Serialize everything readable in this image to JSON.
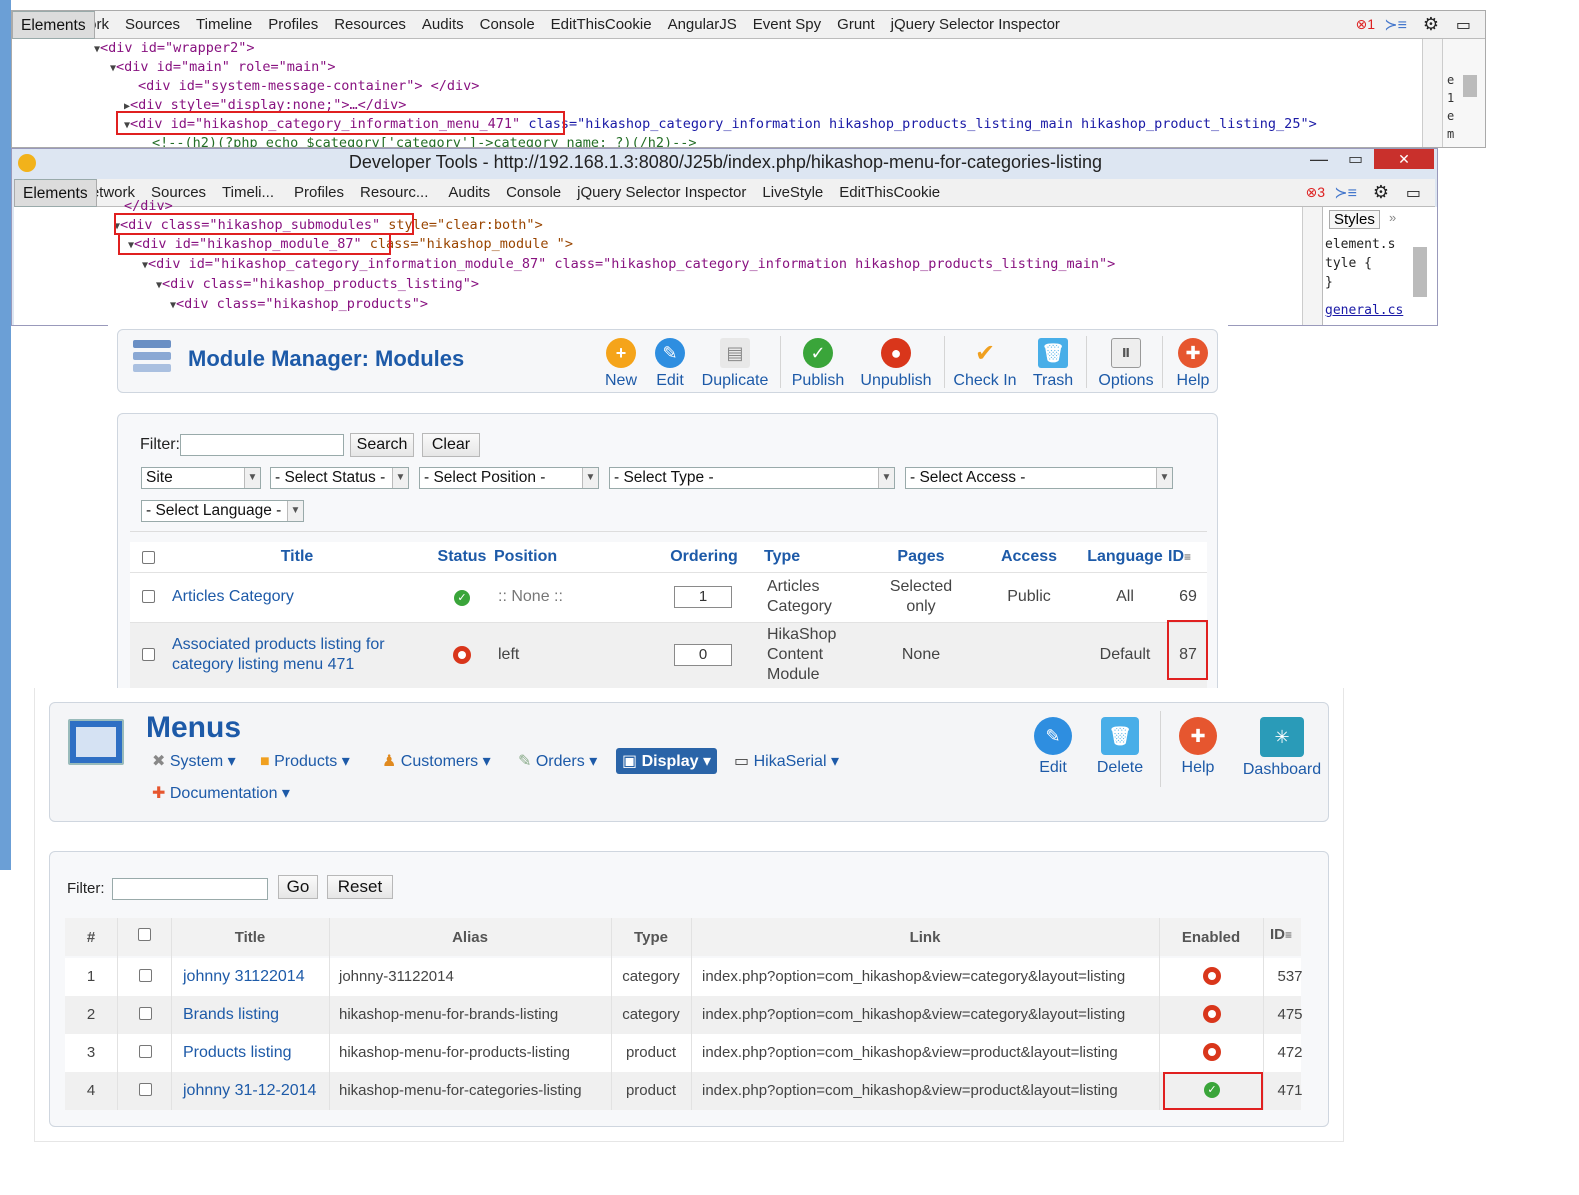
{
  "devtools1": {
    "tabs": [
      "Elements",
      "Network",
      "Sources",
      "Timeline",
      "Profiles",
      "Resources",
      "Audits",
      "Console",
      "EditThisCookie",
      "AngularJS",
      "Event Spy",
      "Grunt",
      "jQuery Selector Inspector"
    ],
    "error_count": "1",
    "lines": [
      {
        "tag": "<div id=\"wrapper2\">"
      },
      {
        "tag": "<div id=\"main\" role=\"main\">"
      },
      {
        "tag": "<div id=\"system-message-container\"> </div>"
      },
      {
        "tag": "<div style=\"display:none;\">…</div>"
      },
      {
        "tag": "<div id=\"hikashop_category_information_menu_471\"",
        "rest": "class=\"hikashop_category_information hikashop_products_listing_main hikashop_product_listing_25\">"
      },
      {
        "tag": "<!--(h2)(?php echo $category['category']->category_name; ?)(/h2)-->"
      }
    ],
    "side": [
      "e",
      "1",
      "e",
      "m"
    ]
  },
  "devtools2": {
    "title": "Developer Tools - http://192.168.1.3:8080/J25b/index.php/hikashop-menu-for-categories-listing",
    "tabs": [
      "Elements",
      "Network",
      "Sources",
      "Timeli...",
      "Profiles",
      "Resourc...",
      "Audits",
      "Console",
      "jQuery Selector Inspector",
      "LiveStyle",
      "EditThisCookie"
    ],
    "error_count": "3",
    "lines": [
      {
        "tag": "</div>"
      },
      {
        "tag": "<div class=\"hikashop_submodules\"",
        "rest": "style=\"clear:both\">"
      },
      {
        "tag": "<div id=\"hikashop_module_87\"",
        "rest": "class=\"hikashop_module \">"
      },
      {
        "tag": "<div id=\"hikashop_category_information_module_87\" class=\"hikashop_category_information hikashop_products_listing_main\">"
      },
      {
        "tag": "<div class=\"hikashop_products_listing\">"
      },
      {
        "tag": "<div class=\"hikashop_products\">"
      }
    ],
    "styles_tab": "Styles",
    "styles_lines": [
      "element.s",
      "tyle {",
      "}",
      "general.cs"
    ]
  },
  "module_manager": {
    "title": "Module Manager: Modules",
    "toolbar": [
      "New",
      "Edit",
      "Duplicate",
      "Publish",
      "Unpublish",
      "Check In",
      "Trash",
      "Options",
      "Help"
    ],
    "filter_label": "Filter:",
    "search_btn": "Search",
    "clear_btn": "Clear",
    "selects": [
      "Site",
      "- Select Status -",
      "- Select Position -",
      "- Select Type -",
      "- Select Access -",
      "- Select Language -"
    ],
    "headers": [
      "Title",
      "Status",
      "Position",
      "Ordering",
      "Type",
      "Pages",
      "Access",
      "Language",
      "ID"
    ],
    "rows": [
      {
        "title": "Articles Category",
        "position": ":: None ::",
        "ordering": "1",
        "type1": "Articles",
        "type2": "Category",
        "type3": "",
        "pages1": "Selected",
        "pages2": "only",
        "access": "Public",
        "language": "All",
        "id": "69"
      },
      {
        "title": "Associated products listing for",
        "title2": "category listing menu 471",
        "position": "left",
        "ordering": "0",
        "type1": "HikaShop",
        "type2": "Content",
        "type3": "Module",
        "pages1": "None",
        "pages2": "",
        "access": "",
        "language": "Default",
        "id": "87"
      }
    ]
  },
  "menus": {
    "title": "Menus",
    "nav": [
      "System",
      "Products",
      "Customers",
      "Orders",
      "Display",
      "HikaSerial",
      "Documentation"
    ],
    "toolbar": [
      "Edit",
      "Delete",
      "Help",
      "Dashboard"
    ],
    "filter_label": "Filter:",
    "go_btn": "Go",
    "reset_btn": "Reset",
    "headers": [
      "#",
      "Title",
      "Alias",
      "Type",
      "Link",
      "Enabled",
      "ID"
    ],
    "rows": [
      {
        "num": "1",
        "title": "johnny 31122014",
        "alias": "johnny-31122014",
        "type": "category",
        "link": "index.php?option=com_hikashop&view=category&layout=listing",
        "enabled": false,
        "id": "537"
      },
      {
        "num": "2",
        "title": "Brands listing",
        "alias": "hikashop-menu-for-brands-listing",
        "type": "category",
        "link": "index.php?option=com_hikashop&view=category&layout=listing",
        "enabled": false,
        "id": "475"
      },
      {
        "num": "3",
        "title": "Products listing",
        "alias": "hikashop-menu-for-products-listing",
        "type": "product",
        "link": "index.php?option=com_hikashop&view=product&layout=listing",
        "enabled": false,
        "id": "472"
      },
      {
        "num": "4",
        "title": "johnny 31-12-2014",
        "alias": "hikashop-menu-for-categories-listing",
        "type": "product",
        "link": "index.php?option=com_hikashop&view=product&layout=listing",
        "enabled": true,
        "id": "471"
      }
    ]
  },
  "colors": {
    "accent": "#1d5aa8",
    "highlight": "#e02020",
    "ok": "#3aa53a",
    "no": "#d9361b"
  }
}
